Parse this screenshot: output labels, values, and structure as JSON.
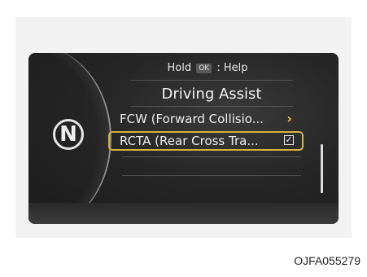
{
  "help": {
    "prefix": "Hold",
    "key": "OK",
    "suffix": ": Help"
  },
  "gear": "N",
  "menu": {
    "title": "Driving Assist",
    "items": [
      {
        "label": "FCW (Forward Collisio...",
        "indicator": "chevron-right-icon",
        "indicator_glyph": "›"
      },
      {
        "label": "RCTA (Rear Cross Tra...",
        "indicator": "checkbox-checked-icon",
        "indicator_glyph": "✓",
        "selected": true
      }
    ]
  },
  "caption": "OJFA055279",
  "colors": {
    "highlight": "#d4b43a",
    "chevron": "#f0c83a"
  }
}
